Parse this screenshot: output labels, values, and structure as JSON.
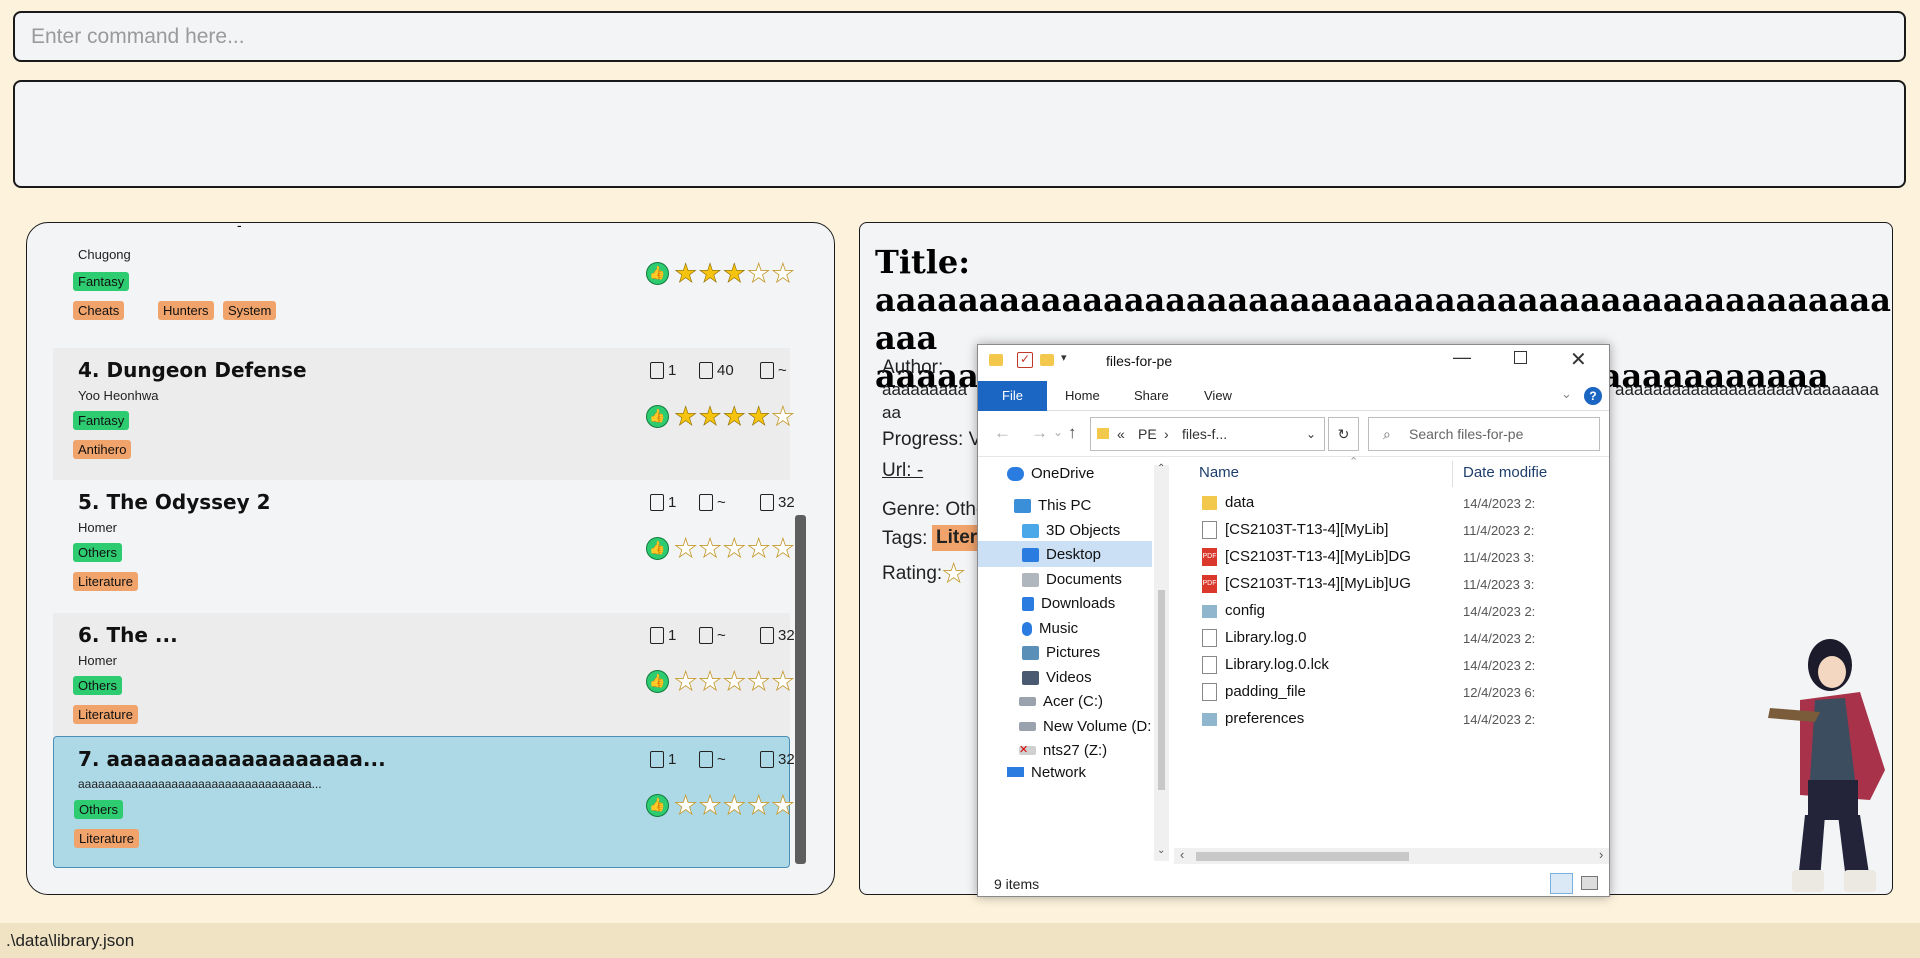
{
  "command": {
    "placeholder": "Enter command here..."
  },
  "list": {
    "books": [
      {
        "index_title": "",
        "author": "Chugong",
        "genre": "Fantasy",
        "tags": [
          "Cheats",
          "Hunters",
          "System"
        ],
        "rating": 3
      },
      {
        "index_title": "4. Dungeon Defense",
        "author": "Yoo Heonhwa",
        "genre": "Fantasy",
        "tags": [
          "Antihero"
        ],
        "rating": 4,
        "volume": "1",
        "chapter": "40",
        "page": "~"
      },
      {
        "index_title": "5. The Odyssey 2",
        "author": "Homer",
        "genre": "Others",
        "tags": [
          "Literature"
        ],
        "rating": 0,
        "volume": "1",
        "chapter": "~",
        "page": "32"
      },
      {
        "index_title": "6. The ...",
        "author": "Homer",
        "genre": "Others",
        "tags": [
          "Literature"
        ],
        "rating": 0,
        "volume": "1",
        "chapter": "~",
        "page": "32"
      },
      {
        "index_title": "7. aaaaaaaaaaaaaaaaaaa...",
        "author": "aaaaaaaaaaaaaaaaaaaaaaaaaaaaaaaaaaa...",
        "genre": "Others",
        "tags": [
          "Literature"
        ],
        "rating": 0,
        "volume": "1",
        "chapter": "~",
        "page": "32"
      }
    ]
  },
  "detail": {
    "title_label": "Title:",
    "title_line1": "aaaaaaaaaaaaaaaaaaaaaaaaaaaaaaaaaaaaaaaaaaaaaaaaaaaaaaaa",
    "title_line2": "aaaaaaaaaaaaaaaaaaaaaaaaaaaaaaaaaaaaaaaaaaaaaa",
    "author_label": "Author:",
    "author_value_left": "aaaaaaaaa",
    "author_value_right": "aaaaaaaaaaaaaaaaaaavaaaaaaaa",
    "author_value_line2": "aa",
    "progress_label": "Progress: V",
    "url_label": "Url: -",
    "genre_label": "Genre: Othe",
    "tags_label": "Tags:",
    "tags_value": "Litera",
    "rating_label": "Rating:"
  },
  "explorer": {
    "title": "files-for-pe",
    "ribbon_tabs": [
      "File",
      "Home",
      "Share",
      "View"
    ],
    "breadcrumb": [
      "«",
      "PE",
      "›",
      "files-f..."
    ],
    "search_placeholder": "Search files-for-pe",
    "nav": [
      {
        "label": "OneDrive",
        "icon": "onedrive-icon"
      },
      {
        "label": "This PC",
        "icon": "pc-icon"
      },
      {
        "label": "3D Objects",
        "icon": "cube-icon"
      },
      {
        "label": "Desktop",
        "icon": "desktop-icon"
      },
      {
        "label": "Documents",
        "icon": "documents-icon"
      },
      {
        "label": "Downloads",
        "icon": "download-icon"
      },
      {
        "label": "Music",
        "icon": "music-icon"
      },
      {
        "label": "Pictures",
        "icon": "pictures-icon"
      },
      {
        "label": "Videos",
        "icon": "videos-icon"
      },
      {
        "label": "Acer (C:)",
        "icon": "drive-icon"
      },
      {
        "label": "New Volume (D:",
        "icon": "drive-icon"
      },
      {
        "label": "nts27 (Z:)",
        "icon": "network-drive-icon"
      },
      {
        "label": "Network",
        "icon": "network-icon"
      }
    ],
    "columns": {
      "name": "Name",
      "date": "Date modifie"
    },
    "files": [
      {
        "name": "data",
        "date": "14/4/2023 2:",
        "icon": "folder-icon"
      },
      {
        "name": "[CS2103T-T13-4][MyLib]",
        "date": "11/4/2023 2:",
        "icon": "jar-icon"
      },
      {
        "name": "[CS2103T-T13-4][MyLib]DG",
        "date": "11/4/2023 3:",
        "icon": "pdf-icon"
      },
      {
        "name": "[CS2103T-T13-4][MyLib]UG",
        "date": "11/4/2023 3:",
        "icon": "pdf-icon"
      },
      {
        "name": "config",
        "date": "14/4/2023 2:",
        "icon": "config-icon"
      },
      {
        "name": "Library.log.0",
        "date": "14/4/2023 2:",
        "icon": "file-icon"
      },
      {
        "name": "Library.log.0.lck",
        "date": "14/4/2023 2:",
        "icon": "file-icon"
      },
      {
        "name": "padding_file",
        "date": "12/4/2023 6:",
        "icon": "file-icon"
      },
      {
        "name": "preferences",
        "date": "14/4/2023 2:",
        "icon": "config-icon"
      }
    ],
    "status": "9 items"
  },
  "status_bar": {
    "path": ".\\data\\library.json"
  },
  "colors": {
    "background": "#fdf3dc",
    "genre": "#2ecc71",
    "tag": "#f0a36b",
    "selected": "#add8e6",
    "star": "#f6c40e"
  }
}
